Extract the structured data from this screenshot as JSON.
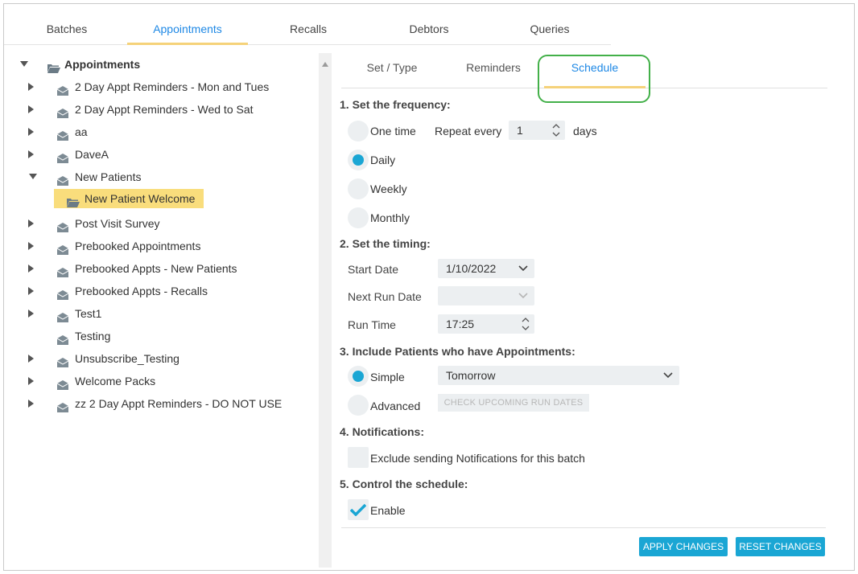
{
  "top_tabs": [
    "Batches",
    "Appointments",
    "Recalls",
    "Debtors",
    "Queries"
  ],
  "tree": {
    "root_label": "Appointments",
    "items": [
      "2 Day Appt Reminders - Mon and Tues",
      "2 Day Appt Reminders - Wed to Sat",
      "aa",
      "DaveA",
      "New Patients",
      "New Patient Welcome",
      "Post Visit Survey",
      "Prebooked Appointments",
      "Prebooked Appts - New Patients",
      "Prebooked Appts - Recalls",
      "Test1",
      "Testing",
      "Unsubscribe_Testing",
      "Welcome Packs",
      "zz 2 Day Appt Reminders - DO NOT USE"
    ],
    "selected": "New Patient Welcome"
  },
  "sub_tabs": [
    "Set / Type",
    "Reminders",
    "Schedule"
  ],
  "schedule": {
    "frequency_title": "1. Set the frequency:",
    "freq_options": [
      "One time",
      "Daily",
      "Weekly",
      "Monthly"
    ],
    "freq_selected": "Daily",
    "repeat_label": "Repeat every",
    "repeat_value": "1",
    "repeat_unit": "days",
    "timing_title": "2. Set the timing:",
    "start_date_label": "Start Date",
    "start_date_value": "1/10/2022",
    "next_run_label": "Next Run Date",
    "next_run_value": "",
    "run_time_label": "Run Time",
    "run_time_value": "17:25",
    "include_title": "3. Include Patients who have Appointments:",
    "simple_label": "Simple",
    "simple_value": "Tomorrow",
    "advanced_label": "Advanced",
    "check_dates_label": "CHECK UPCOMING RUN DATES",
    "include_selected": "Simple",
    "notifications_title": "4. Notifications:",
    "exclude_notifications_label": "Exclude sending Notifications for this batch",
    "exclude_notifications_checked": false,
    "control_title": "5. Control the schedule:",
    "enable_label": "Enable",
    "enable_checked": true
  },
  "buttons": {
    "apply": "APPLY CHANGES",
    "reset": "RESET CHANGES"
  },
  "colors": {
    "accent": "#1aa6d4",
    "tab_active_text": "#1e88e5",
    "tab_underline": "#f5d27a",
    "selected_node": "#f9dd7c",
    "highlight_ring": "#43b049"
  }
}
